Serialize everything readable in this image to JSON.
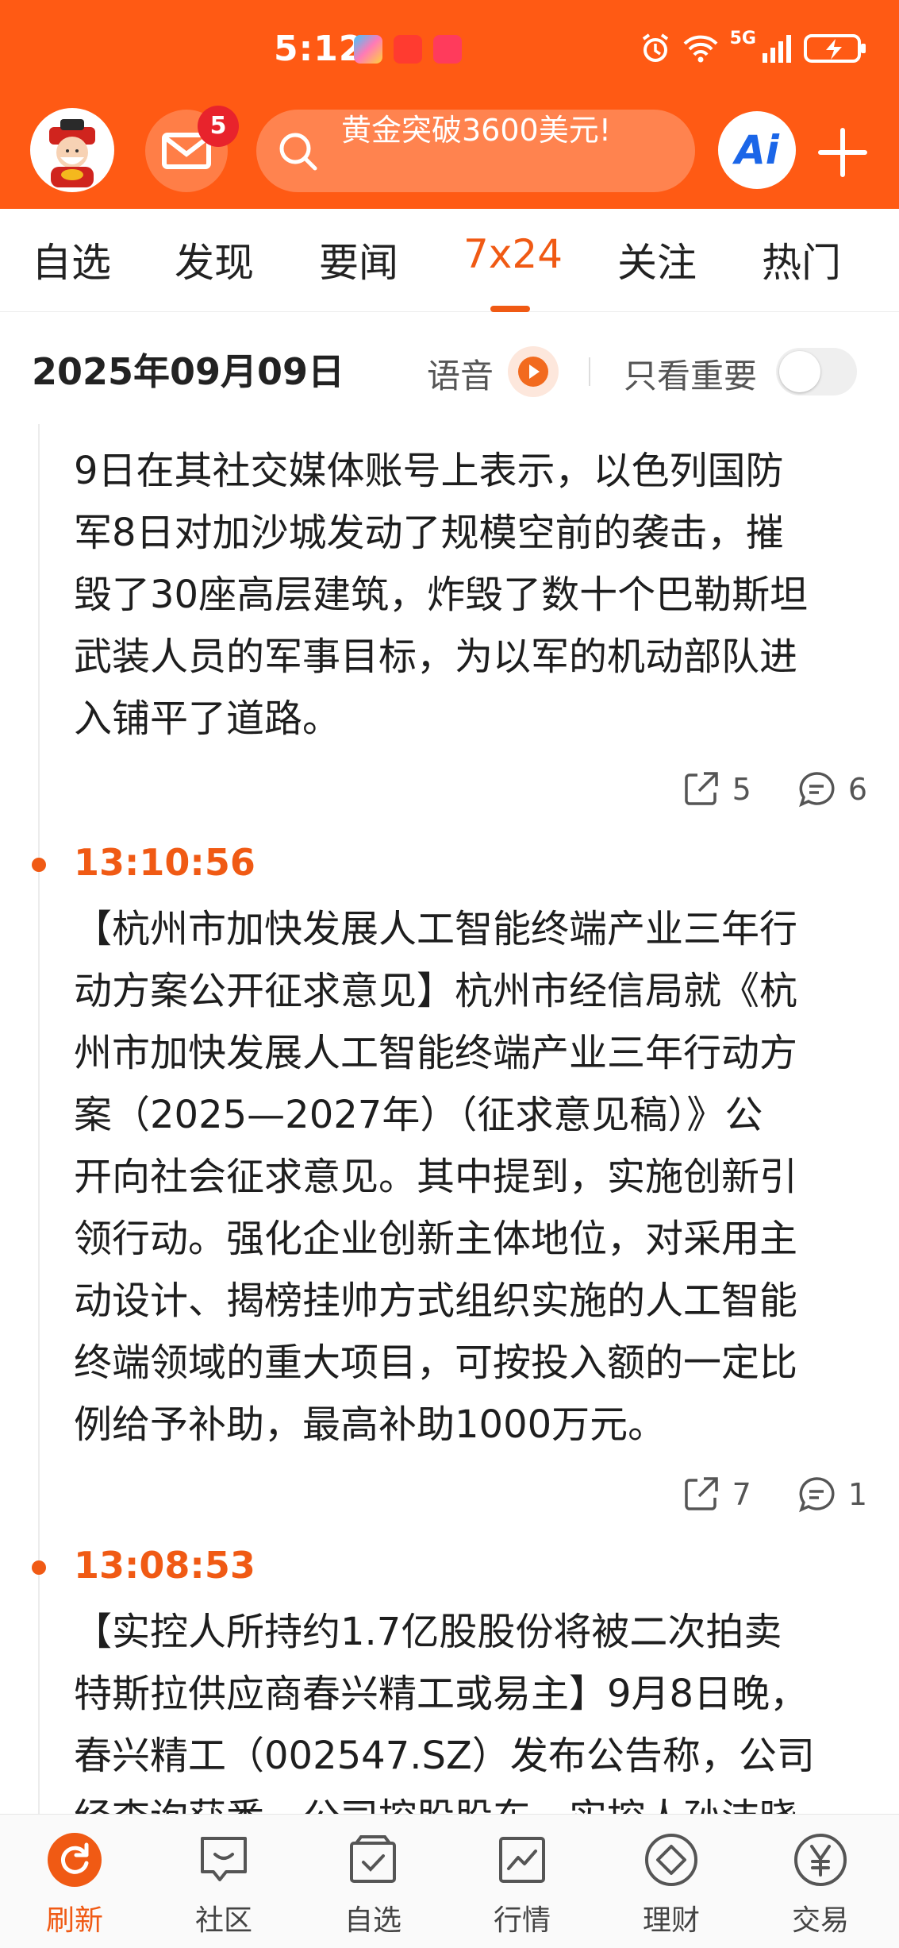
{
  "status_bar": {
    "time": "5:12",
    "network": "5G"
  },
  "header": {
    "mail_badge": "5",
    "search_text": "黄金突破3600美元!",
    "ai_label": "Ai"
  },
  "tabs": [
    {
      "label": "自选"
    },
    {
      "label": "发现"
    },
    {
      "label": "要闻"
    },
    {
      "label": "7x24",
      "active": true
    },
    {
      "label": "关注"
    },
    {
      "label": "热门"
    }
  ],
  "date_row": {
    "date": "2025年09月09日",
    "voice_label": "语音",
    "important_only_label": "只看重要",
    "important_only_on": false
  },
  "news": [
    {
      "time": "",
      "lines": [
        "9日在其社交媒体账号上表示，以色列国防",
        "军8日对加沙城发动了规模空前的袭击，摧",
        "毁了30座高层建筑，炸毁了数十个巴勒斯坦",
        "武装人员的军事目标，为以军的机动部队进",
        "入铺平了道路。"
      ],
      "share_count": "5",
      "comment_count": "6"
    },
    {
      "time": "13:10:56",
      "lines": [
        "【杭州市加快发展人工智能终端产业三年行",
        "动方案公开征求意见】杭州市经信局就《杭",
        "州市加快发展人工智能终端产业三年行动方",
        "案（2025—2027年）（征求意见稿）》公",
        "开向社会征求意见。其中提到，实施创新引",
        "领行动。强化企业创新主体地位，对采用主",
        "动设计、揭榜挂帅方式组织实施的人工智能",
        "终端领域的重大项目，可按投入额的一定比",
        "例给予补助，最高补助1000万元。"
      ],
      "share_count": "7",
      "comment_count": "1"
    },
    {
      "time": "13:08:53",
      "lines": [
        "【实控人所持约1.7亿股股份将被二次拍卖",
        "特斯拉供应商春兴精工或易主】9月8日晚，",
        "春兴精工（002547.SZ）发布公告称，公司",
        "经查询获悉，公司控股股东、实控人孙洁晓"
      ]
    }
  ],
  "bottom_nav": [
    {
      "label": "刷新",
      "icon": "refresh-icon",
      "active": true
    },
    {
      "label": "社区",
      "icon": "chat-bubble-icon"
    },
    {
      "label": "自选",
      "icon": "checklist-icon"
    },
    {
      "label": "行情",
      "icon": "chart-icon"
    },
    {
      "label": "理财",
      "icon": "diamond-icon"
    },
    {
      "label": "交易",
      "icon": "yen-icon"
    }
  ],
  "colors": {
    "brand_orange": "#ff5a14",
    "accent": "#f05a14",
    "badge_red": "#e8232c",
    "ai_blue": "#1b66e8"
  }
}
